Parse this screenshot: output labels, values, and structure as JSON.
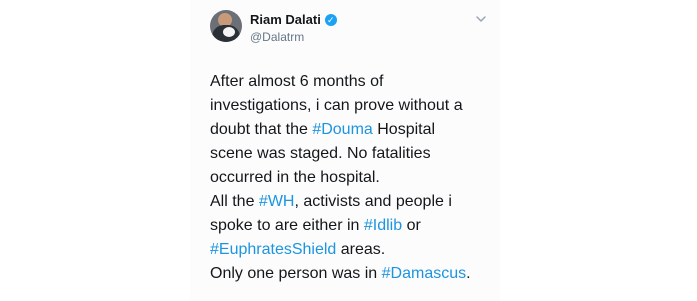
{
  "author": {
    "display_name": "Riam Dalati",
    "handle": "@Dalatrm",
    "verified": true
  },
  "tweet": {
    "lines": [
      [
        {
          "t": "After almost 6 months of"
        }
      ],
      [
        {
          "t": "investigations, i can prove without a"
        }
      ],
      [
        {
          "t": "doubt that the "
        },
        {
          "t": "#Douma",
          "tag": true
        },
        {
          "t": " Hospital"
        }
      ],
      [
        {
          "t": "scene was staged. No fatalities"
        }
      ],
      [
        {
          "t": "occurred in the hospital."
        }
      ],
      [
        {
          "t": "All the "
        },
        {
          "t": "#WH",
          "tag": true
        },
        {
          "t": ", activists and people i"
        }
      ],
      [
        {
          "t": "spoke to are either in "
        },
        {
          "t": "#Idlib",
          "tag": true
        },
        {
          "t": " or"
        }
      ],
      [
        {
          "t": "#EuphratesShield",
          "tag": true
        },
        {
          "t": " areas."
        }
      ],
      [
        {
          "t": "Only one person was in "
        },
        {
          "t": "#Damascus",
          "tag": true
        },
        {
          "t": "."
        }
      ]
    ]
  },
  "colors": {
    "hashtag": "#1b95e0",
    "verified": "#1da1f2",
    "text": "#14171a",
    "muted": "#657786"
  },
  "icons": {
    "verified": "verified-badge-icon",
    "more": "chevron-down-icon"
  }
}
